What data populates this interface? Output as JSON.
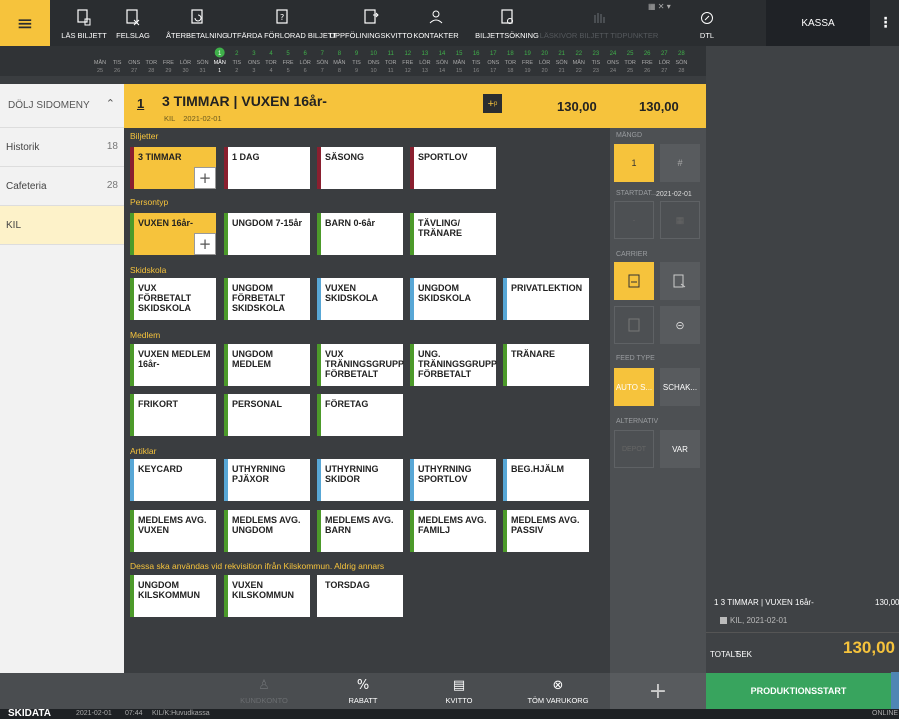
{
  "topbar": {
    "buttons": [
      {
        "label": "LÄS BILJETT"
      },
      {
        "label": "FELSLAG"
      },
      {
        "label": "ÅTERBETALNING"
      },
      {
        "label": "UTFÄRDA FÖRLORAD BILJETT"
      },
      {
        "label": "UPPFÖLININGSKVITTO"
      },
      {
        "label": "KONTAKTER"
      },
      {
        "label": "BILJETTSÖKNING"
      },
      {
        "label": "LÄSKIVOR BILJETT TIDPUNKTER"
      },
      {
        "label": "DTL"
      }
    ],
    "kassa": "KASSA"
  },
  "calendar": {
    "week_top": [
      "1",
      "2",
      "3",
      "4",
      "5",
      "6",
      "7",
      "8",
      "9",
      "10",
      "11",
      "12",
      "13",
      "14",
      "15",
      "16",
      "17",
      "18",
      "19",
      "20",
      "21",
      "22",
      "23",
      "24",
      "25",
      "26",
      "27",
      "28"
    ],
    "days": [
      "MÅN",
      "TIS",
      "ONS",
      "TOR",
      "FRE",
      "LÖR",
      "SÖN",
      "MÅN",
      "TIS",
      "ONS",
      "TOR",
      "FRE",
      "LÖR",
      "SÖN",
      "MÅN",
      "TIS",
      "ONS",
      "TOR",
      "FRE",
      "LÖR",
      "SÖN",
      "MÅN",
      "TIS",
      "ONS",
      "TOR",
      "FRE",
      "LÖR",
      "SÖN",
      "MÅN",
      "TIS",
      "ONS",
      "TOR",
      "FRE",
      "LÖR",
      "SÖN"
    ],
    "dates": [
      "25",
      "26",
      "27",
      "28",
      "29",
      "30",
      "31",
      "1",
      "2",
      "3",
      "4",
      "5",
      "6",
      "7",
      "8",
      "9",
      "10",
      "11",
      "12",
      "13",
      "14",
      "15",
      "16",
      "17",
      "18",
      "19",
      "20",
      "21",
      "22",
      "23",
      "24",
      "25",
      "26",
      "27",
      "28"
    ],
    "highlight_color": "#3fb04a"
  },
  "sidebar": {
    "toggle": "DÖLJ SIDOMENY",
    "items": [
      {
        "label": "Historik",
        "count": "18"
      },
      {
        "label": "Cafeteria",
        "count": "28"
      },
      {
        "label": "KIL",
        "count": ""
      }
    ]
  },
  "header": {
    "num": "1",
    "title": "3 TIMMAR | VUXEN 16år-",
    "sub1": "KIL",
    "sub2": "2021-02-01",
    "price1": "130,00",
    "price2": "130,00"
  },
  "categories": [
    {
      "label": "Biljetter"
    },
    {
      "label": "Persontyp"
    },
    {
      "label": "Skidskola"
    },
    {
      "label": "Medlem"
    },
    {
      "label": "Artiklar"
    },
    {
      "label": "Dessa ska användas vid rekvisition ifrån Kilskommun. Aldrig annars"
    }
  ],
  "tiles": [
    {
      "label": "3 TIMMAR"
    },
    {
      "label": "1 DAG"
    },
    {
      "label": "SÄSONG"
    },
    {
      "label": "SPORTLOV"
    },
    {
      "label": "VUXEN 16år-"
    },
    {
      "label": "UNGDOM 7-15år"
    },
    {
      "label": "BARN 0-6år"
    },
    {
      "label": "TÄVLING/ TRÄNARE"
    },
    {
      "label": "VUX FÖRBETALT SKIDSKOLA"
    },
    {
      "label": "UNGDOM FÖRBETALT SKIDSKOLA"
    },
    {
      "label": "VUXEN SKIDSKOLA"
    },
    {
      "label": "UNGDOM SKIDSKOLA"
    },
    {
      "label": "PRIVATLEKTION"
    },
    {
      "label": "VUXEN MEDLEM 16år-"
    },
    {
      "label": "UNGDOM MEDLEM"
    },
    {
      "label": "VUX TRÄNINGSGRUPP FÖRBETALT"
    },
    {
      "label": "UNG. TRÄNINGSGRUPP FÖRBETALT"
    },
    {
      "label": "TRÄNARE"
    },
    {
      "label": "FRIKORT"
    },
    {
      "label": "PERSONAL"
    },
    {
      "label": "FÖRETAG"
    },
    {
      "label": "KEYCARD"
    },
    {
      "label": "UTHYRNING PJÄXOR"
    },
    {
      "label": "UTHYRNING SKIDOR"
    },
    {
      "label": "UTHYRNING SPORTLOV"
    },
    {
      "label": "BEG.HJÄLM"
    },
    {
      "label": "MEDLEMS AVG. VUXEN"
    },
    {
      "label": "MEDLEMS AVG. UNGDOM"
    },
    {
      "label": "MEDLEMS AVG. BARN"
    },
    {
      "label": "MEDLEMS AVG. FAMILJ"
    },
    {
      "label": "MEDLEMS AVG. PASSIV"
    },
    {
      "label": "UNGDOM KILSKOMMUN"
    },
    {
      "label": "VUXEN KILSKOMMUN"
    },
    {
      "label": "TORSDAG"
    }
  ],
  "props": {
    "mangd": "MÄNGD",
    "mangd_val": "1",
    "hash": "#",
    "startdat": "STARTDAT...",
    "startdat_val": "2021-02-01",
    "carrier": "CARRIER",
    "feed_type": "FEED TYPE",
    "auto": "AUTO S...",
    "schak": "SCHAK...",
    "alternativ": "ALTERNATIV",
    "alt_dim": "DEPOT",
    "var": "VAR"
  },
  "bottom": {
    "kundkonto": "KUNDKONTO",
    "rabatt": "RABATT",
    "kvitto": "KVITTO",
    "tom": "TÖM VARUKORG",
    "prod": "PRODUKTIONSSTART"
  },
  "cart": {
    "line": "1   3 TIMMAR | VUXEN 16år-",
    "line_price": "130,00",
    "line_sub": "KIL, 2021-02-01",
    "total_label": "TOTALT",
    "currency": "SEK",
    "total": "130,00"
  },
  "status": {
    "brand": "SKIDATA",
    "date": "2021-02-01",
    "time": "07:44",
    "location": "KIL/K:Huvudkassa",
    "online": "ONLINE"
  }
}
